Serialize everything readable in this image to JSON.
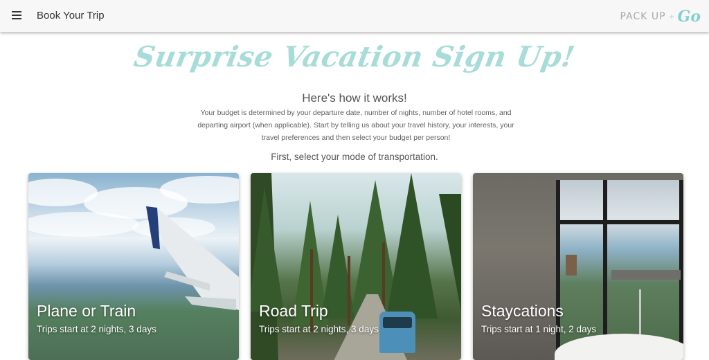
{
  "appbar": {
    "title": "Book Your Trip",
    "menu_icon": "hamburger-menu-icon",
    "brand": {
      "text": "PACK UP",
      "plus": "+",
      "go": "Go"
    }
  },
  "main": {
    "headline": "Surprise Vacation Sign Up!",
    "subhead": "Here's how it works!",
    "description": "Your budget is determined by your departure date, number of nights, number of hotel rooms, and departing airport (when applicable). Start by telling us about your travel history, your interests, your travel preferences and then select your budget per person!",
    "prompt": "First, select your mode of transportation."
  },
  "cards": [
    {
      "title": "Plane or Train",
      "subtitle": "Trips start at 2 nights, 3 days"
    },
    {
      "title": "Road Trip",
      "subtitle": "Trips start at 2 nights, 3 days"
    },
    {
      "title": "Staycations",
      "subtitle": "Trips start at 1 night, 2 days"
    }
  ],
  "colors": {
    "headline": "#a8dcd8",
    "brand_accent": "#86cfcb",
    "appbar_bg": "#f7f7f7"
  }
}
